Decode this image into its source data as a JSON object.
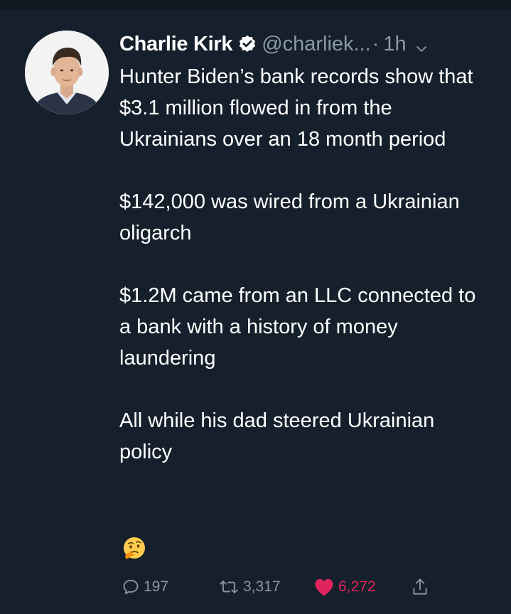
{
  "tweet": {
    "author_name": "Charlie Kirk",
    "handle": "@charliek...",
    "separator": "·",
    "time": "1h",
    "paragraphs": [
      "Hunter Biden’s bank records show that $3.1 million flowed in from the Ukrainians over an 18 month period",
      "$142,000 was wired from a Ukrainian oligarch",
      "$1.2M came from an LLC connected to a bank with a history of money laundering",
      "All while his dad steered Ukrainian policy"
    ],
    "emoji": "thinking-face",
    "verified_icon": "verified-badge-icon",
    "menu_icon": "chevron-down-icon"
  },
  "actions": {
    "replies": "197",
    "retweets": "3,317",
    "likes": "6,272"
  },
  "colors": {
    "background": "#16202c",
    "text": "#ffffff",
    "secondary": "#8b98a5",
    "like": "#e0245e",
    "verified_badge": "#ffffff"
  }
}
